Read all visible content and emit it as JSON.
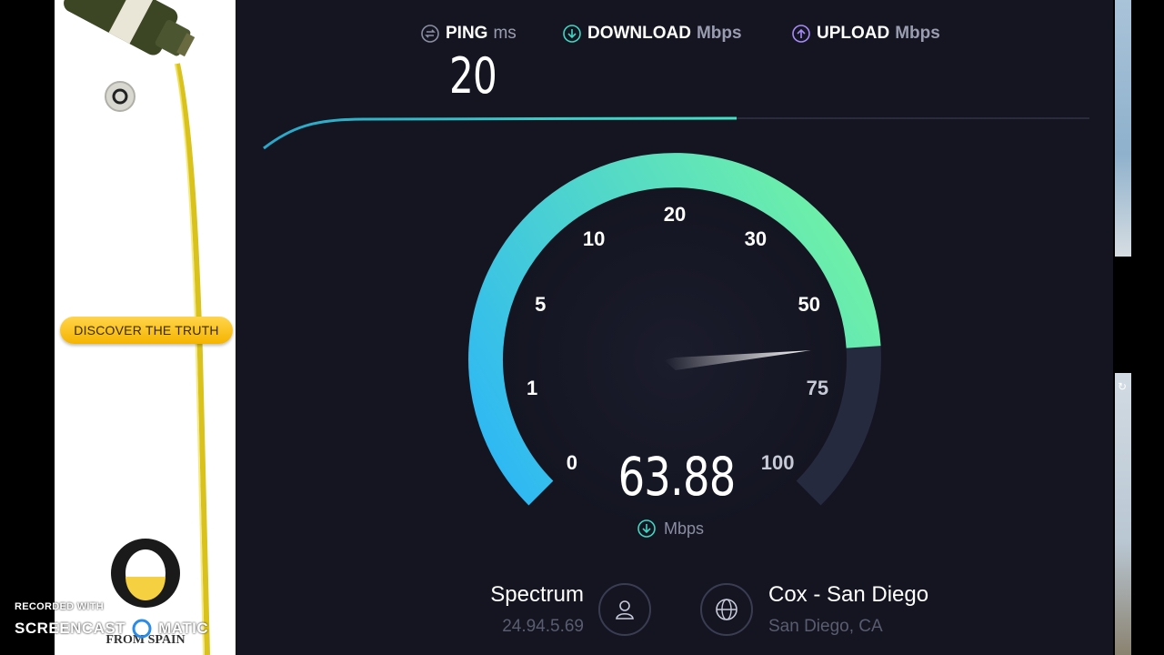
{
  "ad": {
    "button_label": "DISCOVER THE TRUTH",
    "bottle_label": "FROM SPAIN",
    "logo_text": "FROM SPAIN"
  },
  "metrics": {
    "ping": {
      "label": "PING",
      "unit": "ms",
      "value": "20"
    },
    "download": {
      "label": "DOWNLOAD",
      "unit": "Mbps"
    },
    "upload": {
      "label": "UPLOAD",
      "unit": "Mbps"
    }
  },
  "gauge": {
    "ticks": [
      "0",
      "1",
      "5",
      "10",
      "20",
      "30",
      "50",
      "75",
      "100"
    ],
    "current_value": 63.88,
    "max_value": 100,
    "value_text": "63.88",
    "unit": "Mbps"
  },
  "isp": {
    "name": "Spectrum",
    "ip": "24.94.5.69"
  },
  "server": {
    "name": "Cox - San Diego",
    "location": "San Diego, CA"
  },
  "watermark": {
    "line1": "RECORDED WITH",
    "line2a": "SCREENCAST",
    "line2b": "MATIC"
  },
  "colors": {
    "background": "#141521",
    "gauge_start": "#2db7f5",
    "gauge_end": "#6ef0a8",
    "accent_teal": "#3fd6c1",
    "upload_purple": "#a78bfa"
  }
}
